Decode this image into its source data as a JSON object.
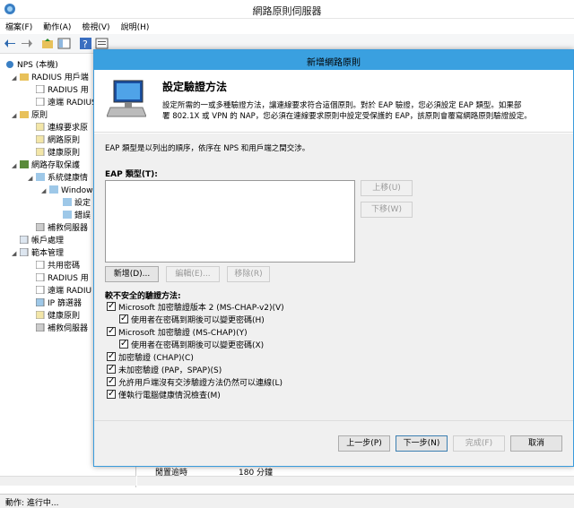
{
  "window": {
    "title": "網路原則伺服器"
  },
  "menu": [
    "檔案(F)",
    "動作(A)",
    "檢視(V)",
    "說明(H)"
  ],
  "tree": {
    "root": "NPS (本機)",
    "items": [
      "RADIUS 用戶端",
      "RADIUS 用",
      "遠端 RADIUS",
      "原則",
      "連線要求原",
      "網路原則",
      "健康原則",
      "網路存取保護",
      "系統健康情",
      "Window",
      "設定",
      "錯誤",
      "補救伺服器",
      "帳戶處理",
      "範本管理",
      "共用密碼",
      "RADIUS 用",
      "遠端 RADIU",
      "IP 篩選器",
      "健康原則",
      "補救伺服器"
    ]
  },
  "right_pane": {
    "row_label": "閒置逾時",
    "row_value": "180 分鐘"
  },
  "status": "動作: 進行中...",
  "dialog": {
    "title": "新增網路原則",
    "heading": "設定驗證方法",
    "description_line1": "設定所需的一或多種驗證方法，讓連線要求符合這個原則。對於 EAP 驗證，您必須設定 EAP 類型。如果部",
    "description_line2": "署 802.1X 或 VPN 的 NAP，您必須在連線要求原則中設定受保護的 EAP，該原則會覆寫網路原則驗證設定。",
    "eap_info": "EAP 類型是以列出的順序，依序在 NPS 和用戶端之間交涉。",
    "eap_label": "EAP 類型(T):",
    "move_up": "上移(U)",
    "move_down": "下移(W)",
    "add": "新增(D)...",
    "edit": "編輯(E)...",
    "remove": "移除(R)",
    "less_secure_label": "較不安全的驗證方法:",
    "methods": [
      {
        "label": "Microsoft 加密驗證版本 2 (MS-CHAP-v2)(V)",
        "checked": true
      },
      {
        "label": "使用者在密碼到期後可以變更密碼(H)",
        "checked": true
      },
      {
        "label": "Microsoft 加密驗證 (MS-CHAP)(Y)",
        "checked": true
      },
      {
        "label": "使用者在密碼到期後可以變更密碼(X)",
        "checked": true
      },
      {
        "label": "加密驗證 (CHAP)(C)",
        "checked": true
      },
      {
        "label": "未加密驗證 (PAP，SPAP)(S)",
        "checked": true
      },
      {
        "label": "允許用戶端沒有交涉驗證方法仍然可以連線(L)",
        "checked": true
      },
      {
        "label": "僅執行電腦健康情況檢查(M)",
        "checked": true
      }
    ],
    "back": "上一步(P)",
    "next": "下一步(N)",
    "finish": "完成(F)",
    "cancel": "取消"
  },
  "colors": {
    "dialog_title_bg": "#3aa0e0",
    "dialog_border": "#3a9bdc",
    "body_bg": "#f0f0f0"
  }
}
